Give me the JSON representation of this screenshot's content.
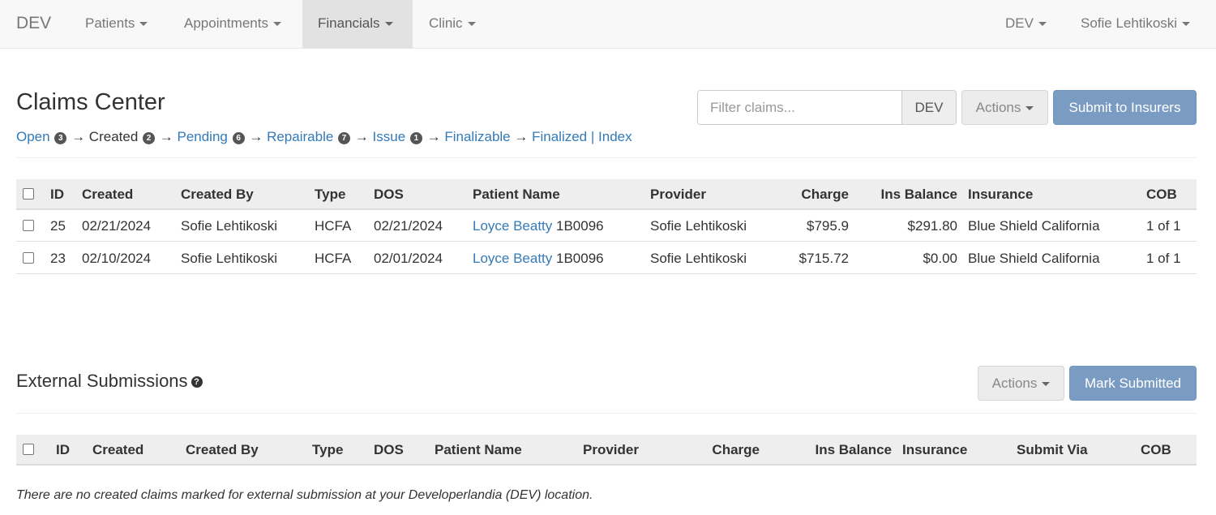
{
  "navbar": {
    "brand": "DEV",
    "menus": [
      "Patients",
      "Appointments",
      "Financials",
      "Clinic"
    ],
    "right_menus": [
      "DEV",
      "Sofie Lehtikoski"
    ]
  },
  "header": {
    "title": "Claims Center",
    "pipeline": {
      "open": "Open",
      "open_count": "3",
      "created": "Created",
      "created_count": "2",
      "pending": "Pending",
      "pending_count": "6",
      "repairable": "Repairable",
      "repairable_count": "7",
      "issue": "Issue",
      "issue_count": "1",
      "finalizable": "Finalizable",
      "finalized": "Finalized",
      "index": "Index",
      "arrow": "→",
      "bar": "|"
    },
    "filter_placeholder": "Filter claims...",
    "filter_addon": "DEV",
    "actions_label": "Actions",
    "submit_label": "Submit to Insurers"
  },
  "claims_table": {
    "columns": [
      "ID",
      "Created",
      "Created By",
      "Type",
      "DOS",
      "Patient Name",
      "Provider",
      "Charge",
      "Ins Balance",
      "Insurance",
      "COB"
    ],
    "rows": [
      {
        "id": "25",
        "created": "02/21/2024",
        "created_by": "Sofie Lehtikoski",
        "type": "HCFA",
        "dos": "02/21/2024",
        "patient": "Loyce Beatty",
        "patient_code": "1B0096",
        "provider": "Sofie Lehtikoski",
        "charge": "$795.9",
        "ins_balance": "$291.80",
        "insurance": "Blue Shield California",
        "cob": "1 of 1"
      },
      {
        "id": "23",
        "created": "02/10/2024",
        "created_by": "Sofie Lehtikoski",
        "type": "HCFA",
        "dos": "02/01/2024",
        "patient": "Loyce Beatty",
        "patient_code": "1B0096",
        "provider": "Sofie Lehtikoski",
        "charge": "$715.72",
        "ins_balance": "$0.00",
        "insurance": "Blue Shield California",
        "cob": "1 of 1"
      }
    ]
  },
  "external": {
    "title": "External Submissions",
    "help_icon": "?",
    "actions_label": "Actions",
    "mark_label": "Mark Submitted",
    "columns": [
      "ID",
      "Created",
      "Created By",
      "Type",
      "DOS",
      "Patient Name",
      "Provider",
      "Charge",
      "Ins Balance",
      "Insurance",
      "Submit Via",
      "COB"
    ],
    "empty_message": "There are no created claims marked for external submission at your Developerlandia (DEV) location."
  },
  "colors": {
    "link": "#337ab7",
    "primary_button": "#7a9cc2",
    "navbar_bg": "#f8f8f8",
    "active_nav": "#e2e2e2"
  }
}
